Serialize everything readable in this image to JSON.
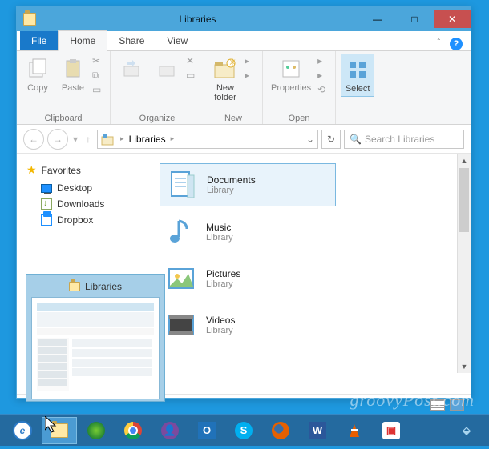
{
  "window": {
    "title": "Libraries",
    "sys": {
      "min": "—",
      "max": "□",
      "close": "✕"
    }
  },
  "tabs": {
    "file": "File",
    "home": "Home",
    "share": "Share",
    "view": "View"
  },
  "ribbon": {
    "copy": "Copy",
    "paste": "Paste",
    "clipboard": "Clipboard",
    "organize": "Organize",
    "newfolder": "New\nfolder",
    "new": "New",
    "properties": "Properties",
    "open": "Open",
    "select": "Select"
  },
  "addr": {
    "root": "Libraries",
    "refresh": "↻"
  },
  "search": {
    "placeholder": "Search Libraries"
  },
  "sidebar": {
    "favorites": "Favorites",
    "items": [
      "Desktop",
      "Downloads",
      "Dropbox"
    ]
  },
  "libs": [
    {
      "name": "Documents",
      "sub": "Library"
    },
    {
      "name": "Music",
      "sub": "Library"
    },
    {
      "name": "Pictures",
      "sub": "Library"
    },
    {
      "name": "Videos",
      "sub": "Library"
    }
  ],
  "preview": {
    "title": "Libraries"
  },
  "watermark": "groovyPost.com"
}
